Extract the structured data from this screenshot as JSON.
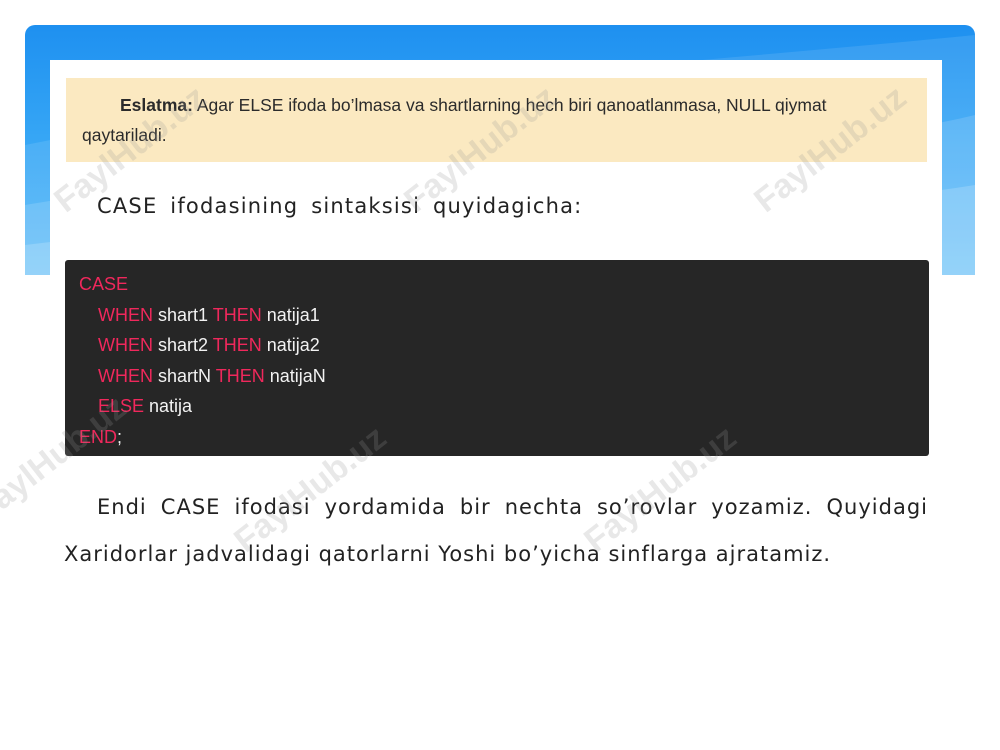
{
  "note": {
    "label": "Eslatma:",
    "text": " Agar ELSE ifoda bo’lmasa va shartlarning hech biri qanoatlanmasa, NULL qiymat qaytariladi."
  },
  "intro": "CASE ifodasining sintaksisi quyidagicha:",
  "code": {
    "case_kw": "CASE",
    "when_kw": "WHEN",
    "then_kw": "THEN",
    "else_kw": "ELSE",
    "end_kw": "END",
    "end_punct": ";",
    "rows": [
      {
        "cond": " shart1 ",
        "result": " natija1"
      },
      {
        "cond": " shart2 ",
        "result": " natija2"
      },
      {
        "cond": " shartN ",
        "result": " natijaN"
      }
    ],
    "else_result": " natija"
  },
  "body": "Endi CASE ifodasi yordamida bir nechta so’rovlar yozamiz. Quyidagi Xaridorlar jadvalidagi qatorlarni Yoshi bo’yicha sinflarga ajratamiz.",
  "watermark": "FaylHub.uz",
  "colors": {
    "banner": "#2f9cf2",
    "note_bg": "#fbe9c1",
    "code_bg": "#262626",
    "keyword": "#f0285c"
  }
}
